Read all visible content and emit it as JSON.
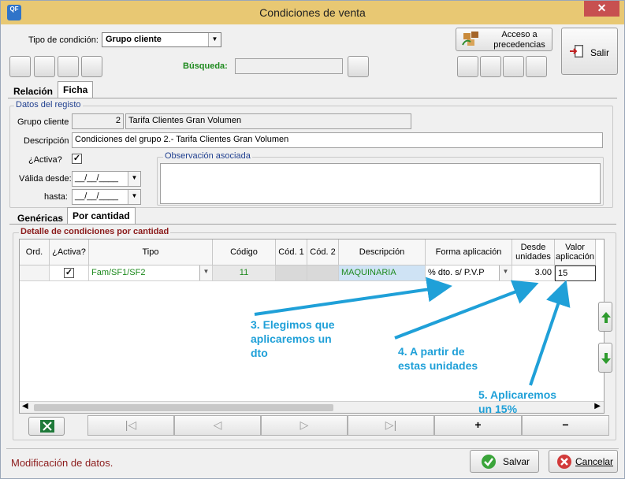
{
  "window": {
    "title": "Condiciones de venta",
    "app_icon_text": "QF",
    "close_label": "✕"
  },
  "header": {
    "tipo_label": "Tipo de condición:",
    "tipo_value": "Grupo cliente",
    "busqueda_label": "Búsqueda:",
    "busqueda_value": "",
    "acceso_label_1": "Acceso a",
    "acceso_label_2": "precedencias",
    "salir_label": "Salir"
  },
  "tabs": [
    {
      "label": "Relación"
    },
    {
      "label": "Ficha"
    }
  ],
  "datos": {
    "group_label": "Datos del registo",
    "grupo_label": "Grupo cliente",
    "grupo_code": "2",
    "grupo_name": "Tarifa Clientes Gran Volumen",
    "descripcion_label": "Descripción",
    "descripcion_value": "Condiciones del grupo 2.- Tarifa Clientes Gran Volumen",
    "activa_label": "¿Activa?",
    "activa_checked": "✓",
    "valida_label": "Válida desde:",
    "valida_value": "__/__/____",
    "hasta_label": "hasta:",
    "hasta_value": "__/__/____",
    "observacion_label": "Observación asociada",
    "observacion_value": ""
  },
  "subtabs": [
    {
      "label": "Genéricas"
    },
    {
      "label": "Por cantidad"
    }
  ],
  "detalle": {
    "group_label": "Detalle de condiciones por cantidad",
    "columns": [
      "Ord.",
      "¿Activa?",
      "Tipo",
      "Código",
      "Cód. 1",
      "Cód. 2",
      "Descripción",
      "Forma aplicación",
      "Desde unidades",
      "Valor aplicación"
    ],
    "row": {
      "ord": "",
      "activa": "✓",
      "tipo": "Fam/SF1/SF2",
      "codigo": "11",
      "cod1": "",
      "cod2": "",
      "descripcion": "MAQUINARIA",
      "forma": "% dto. s/ P.V.P",
      "desde": "3.00",
      "valor": "15"
    }
  },
  "nav": {
    "first": "|◁",
    "prev": "◁",
    "next": "▷",
    "last": "▷|",
    "add": "+",
    "remove": "−"
  },
  "annotations": {
    "a3": [
      "3. Elegimos que",
      "aplicaremos un",
      "dto"
    ],
    "a4": [
      "4. A partir de",
      "estas unidades"
    ],
    "a5": [
      "5. Aplicaremos",
      "un 15%"
    ]
  },
  "status": {
    "message": "Modificación de datos.",
    "guardar_label": "Salvar",
    "cancelar_label": "Cancelar"
  },
  "colors": {
    "titlebar": "#e8c873",
    "annotation": "#1fa0d8",
    "status_text": "#8b1a1a",
    "group_title": "#1f3f8f"
  }
}
